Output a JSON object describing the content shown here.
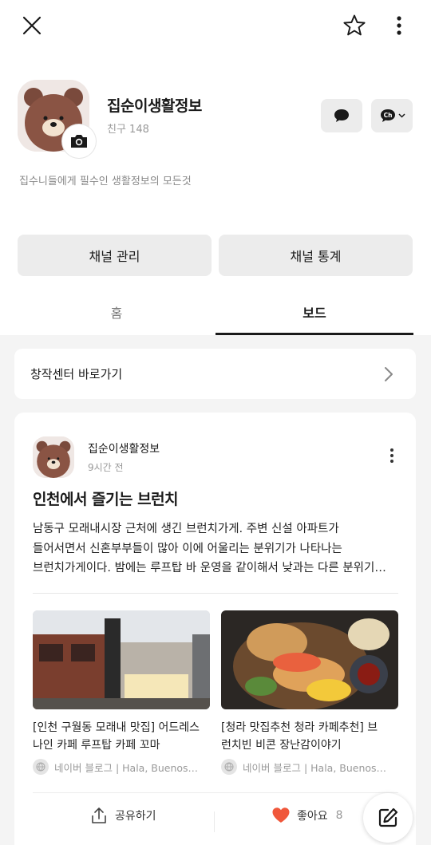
{
  "topbar": {
    "close_icon": "close-icon",
    "favorite_icon": "star-outline-icon",
    "more_icon": "vertical-dots-icon"
  },
  "profile": {
    "name": "집순이생활정보",
    "friends": "친구 148",
    "description": "집수니들에게 필수인 생활정보의 모든것",
    "camera_icon": "camera-icon",
    "chat_icon": "chat-bubble-icon",
    "channel_icon": "ch-channel-icon"
  },
  "actions": {
    "manage": "채널 관리",
    "stats": "채널 통계"
  },
  "tabs": [
    {
      "label": "홈",
      "active": false
    },
    {
      "label": "보드",
      "active": true
    }
  ],
  "creator_center": {
    "label": "창작센터 바로가기"
  },
  "post": {
    "author": "집순이생활정보",
    "time": "9시간 전",
    "title": "인천에서 즐기는 브런치",
    "body_lines": [
      "남동구 모래내시장 근처에 생긴 브런치가게. 주변 신설 아파트가",
      "들어서면서 신혼부부들이 많아 이에 어울리는 분위기가 나타나는",
      "브런치가게이다. 밤에는 루프탑 바 운영을 같이해서 낮과는 다른 분위기…"
    ],
    "links": [
      {
        "title_lines": [
          "[인천 구월동 모래내 맛집] 어드레스",
          "나인 카페 루프탑 카페 꼬마"
        ],
        "source": "네이버 블로그 | Hala, Buenos…"
      },
      {
        "title_lines": [
          "[청라 맛집추천 청라 카페추천] 브",
          "런치빈 비콘 장난감이야기"
        ],
        "source": "네이버 블로그 | Hala, Buenos…"
      }
    ],
    "share_label": "공유하기",
    "like_label": "좋아요",
    "like_count": "8",
    "colors": {
      "like_heart": "#f0573b"
    }
  },
  "fab": {
    "icon": "edit-pencil-icon"
  }
}
